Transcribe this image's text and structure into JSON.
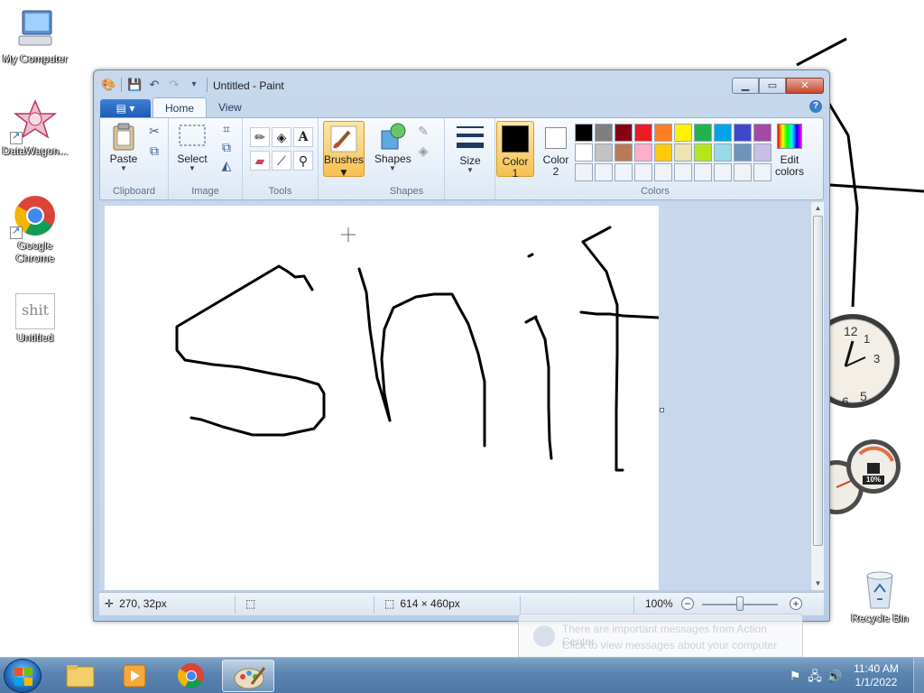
{
  "desktop": {
    "icons": [
      {
        "label": "My Computer"
      },
      {
        "label": "DataWagon..."
      },
      {
        "label": "Google Chrome"
      },
      {
        "label": "Untitled"
      },
      {
        "label": "Recycle Bin"
      }
    ],
    "untitled_thumb_text": "shit"
  },
  "window": {
    "title": "Untitled - Paint",
    "tabs": [
      {
        "label": "Home"
      },
      {
        "label": "View"
      }
    ],
    "active_tab": "Home",
    "help_label": "?",
    "groups": {
      "clipboard": "Clipboard",
      "image": "Image",
      "tools": "Tools",
      "shapes": "Shapes",
      "colors": "Colors"
    },
    "buttons": {
      "paste": "Paste",
      "select": "Select",
      "brushes": "Brushes",
      "shapes": "Shapes",
      "size": "Size",
      "color1_line1": "Color",
      "color1_line2": "1",
      "color2_line1": "Color",
      "color2_line2": "2",
      "edit_colors_line1": "Edit",
      "edit_colors_line2": "colors"
    },
    "palette": [
      "#000000",
      "#7f7f7f",
      "#880015",
      "#ed1c24",
      "#ff7f27",
      "#fff200",
      "#22b14c",
      "#00a2e8",
      "#3f48cc",
      "#a349a4",
      "#ffffff",
      "#c3c3c3",
      "#b97a57",
      "#ffaec9",
      "#ffc90e",
      "#efe4b0",
      "#b5e61d",
      "#99d9ea",
      "#7092be",
      "#c8bfe7",
      "#f0f3f7",
      "#f0f3f7",
      "#f0f3f7",
      "#f0f3f7",
      "#f0f3f7",
      "#f0f3f7",
      "#f0f3f7",
      "#f0f3f7",
      "#f0f3f7",
      "#f0f3f7"
    ],
    "color1": "#000000",
    "color2": "#ffffff",
    "canvas_drawing_text": "shit",
    "status": {
      "cursor_pos": "270, 32px",
      "canvas_size": "614 × 460px",
      "zoom": "100%"
    }
  },
  "notification": {
    "line1": "There are important messages from Action Center",
    "line2": "Click to view messages about your computer"
  },
  "taskbar": {
    "time": "11:40 AM",
    "date": "1/1/2022"
  },
  "gadgets": {
    "cpu_meter_label": "10%"
  }
}
